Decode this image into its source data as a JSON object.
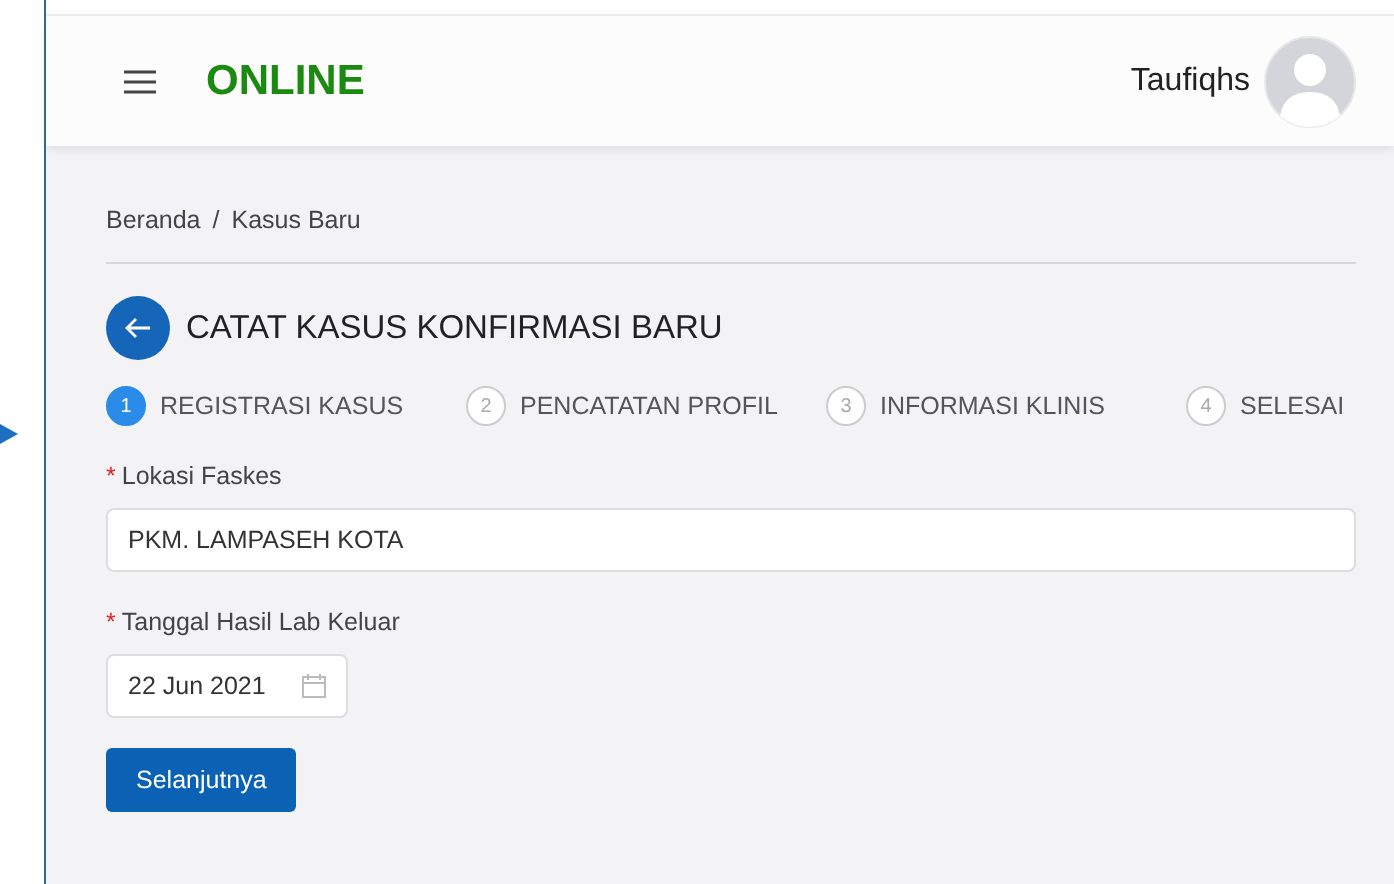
{
  "header": {
    "brand": "ONLINE",
    "user_name": "Taufiqhs"
  },
  "breadcrumb": [
    {
      "label": "Beranda"
    },
    {
      "label": "Kasus Baru"
    }
  ],
  "breadcrumb_separator": "/",
  "page_title": "CATAT KASUS KONFIRMASI BARU",
  "steps": [
    {
      "number": "1",
      "label": "REGISTRASI KASUS",
      "selected": true
    },
    {
      "number": "2",
      "label": "PENCATATAN PROFIL",
      "selected": false
    },
    {
      "number": "3",
      "label": "INFORMASI KLINIS",
      "selected": false
    },
    {
      "number": "4",
      "label": "SELESAI",
      "selected": false
    }
  ],
  "fields": [
    {
      "kind": "text",
      "label": "Lokasi Faskes",
      "required_mark": "*",
      "value": "PKM. LAMPASEH KOTA"
    },
    {
      "kind": "date",
      "label": "Tanggal Hasil Lab Keluar",
      "required_mark": "*",
      "value": "22 Jun 2021"
    }
  ],
  "next_button": "Selanjutnya"
}
